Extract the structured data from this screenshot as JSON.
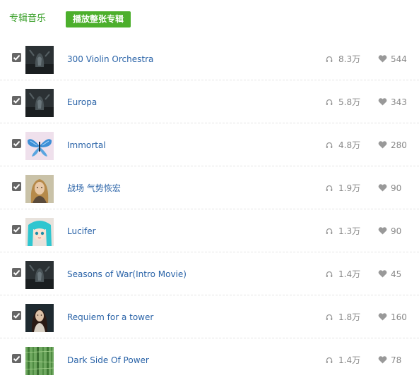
{
  "header": {
    "title": "专辑音乐",
    "play_all_label": "播放整张专辑"
  },
  "colors": {
    "accent_green": "#4caf2c",
    "title_green": "#3aa02a",
    "link_blue": "#2b64a8",
    "meta_gray": "#888888"
  },
  "icons": {
    "checkbox": "checked-checkbox-icon",
    "plays": "headphones-icon",
    "likes": "heart-icon"
  },
  "tracks": [
    {
      "title": "300 Violin Orchestra",
      "plays": "8.3万",
      "likes": "544",
      "checked": true
    },
    {
      "title": "Europa",
      "plays": "5.8万",
      "likes": "343",
      "checked": true
    },
    {
      "title": "Immortal",
      "plays": "4.8万",
      "likes": "280",
      "checked": true
    },
    {
      "title": "战场 气势恢宏",
      "plays": "1.9万",
      "likes": "90",
      "checked": true
    },
    {
      "title": "Lucifer",
      "plays": "1.3万",
      "likes": "90",
      "checked": true
    },
    {
      "title": "Seasons of War(Intro Movie)",
      "plays": "1.4万",
      "likes": "45",
      "checked": true
    },
    {
      "title": "Requiem for a tower",
      "plays": "1.8万",
      "likes": "160",
      "checked": true
    },
    {
      "title": "Dark Side Of Power",
      "plays": "1.4万",
      "likes": "78",
      "checked": true
    }
  ]
}
